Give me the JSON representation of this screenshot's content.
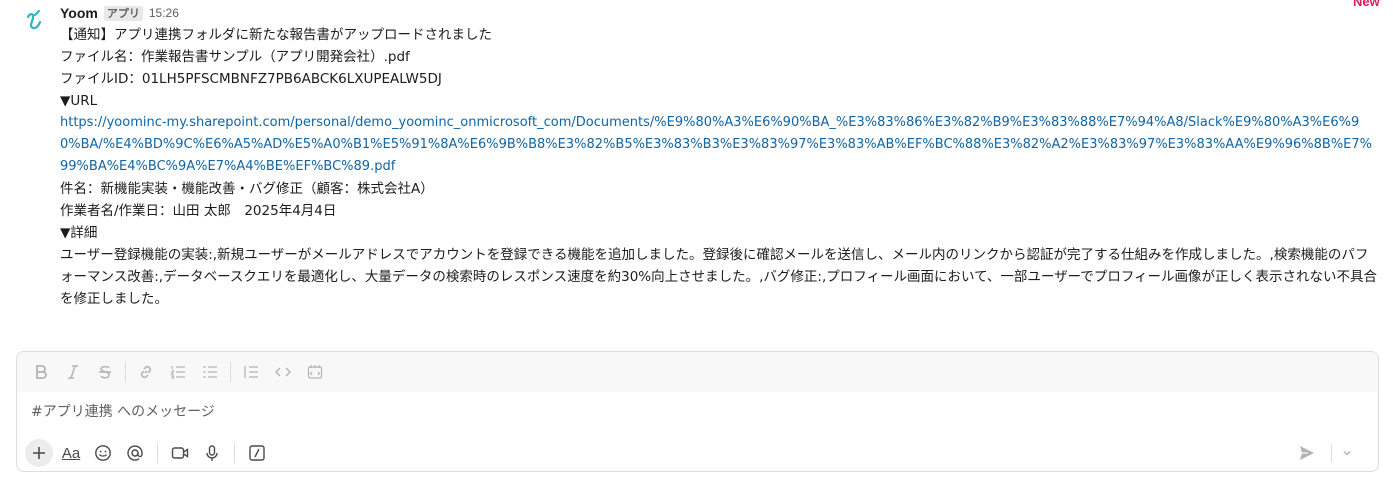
{
  "new_label": "New",
  "message": {
    "sender": "Yoom",
    "app_badge": "アプリ",
    "time": "15:26",
    "lines": {
      "notice": "【通知】アプリ連携フォルダに新たな報告書がアップロードされました",
      "filename": "ファイル名：作業報告書サンプル（アプリ開発会社）.pdf",
      "fileid": "ファイルID：01LH5PFSCMBNFZ7PB6ABCK6LXUPEALW5DJ",
      "url_heading": "▼URL",
      "url": "https://yoominc-my.sharepoint.com/personal/demo_yoominc_onmicrosoft_com/Documents/%E9%80%A3%E6%90%BA_%E3%83%86%E3%82%B9%E3%83%88%E7%94%A8/Slack%E9%80%A3%E6%90%BA/%E4%BD%9C%E6%A5%AD%E5%A0%B1%E5%91%8A%E6%9B%B8%E3%82%B5%E3%83%B3%E3%83%97%E3%83%AB%EF%BC%88%E3%82%A2%E3%83%97%E3%83%AA%E9%96%8B%E7%99%BA%E4%BC%9A%E7%A4%BE%EF%BC%89.pdf",
      "subject": "件名：新機能実装・機能改善・バグ修正（顧客：株式会社A）",
      "worker": "作業者名/作業日：山田 太郎　2025年4月4日",
      "detail_heading": "▼詳細",
      "detail": "ユーザー登録機能の実装:,新規ユーザーがメールアドレスでアカウントを登録できる機能を追加しました。登録後に確認メールを送信し、メール内のリンクから認証が完了する仕組みを作成しました。,検索機能のパフォーマンス改善:,データベースクエリを最適化し、大量データの検索時のレスポンス速度を約30%向上させました。,バグ修正:,プロフィール画面において、一部ユーザーでプロフィール画像が正しく表示されない不具合を修正しました。"
    }
  },
  "composer": {
    "placeholder": "#アプリ連携 へのメッセージ",
    "format_icons": [
      "bold-icon",
      "italic-icon",
      "strikethrough-icon",
      "link-icon",
      "ordered-list-icon",
      "bulleted-list-icon",
      "blockquote-icon",
      "code-icon",
      "code-block-icon"
    ],
    "bottom_icons": [
      "plus-icon",
      "formatting-aa-icon",
      "emoji-icon",
      "mention-icon",
      "video-icon",
      "microphone-icon",
      "slash-command-icon",
      "send-icon",
      "chevron-down-icon"
    ],
    "aa_label": "Aa"
  },
  "colors": {
    "link": "#1264a3",
    "new_label": "#e01e5a",
    "avatar_teal": "#2bb6c4"
  }
}
